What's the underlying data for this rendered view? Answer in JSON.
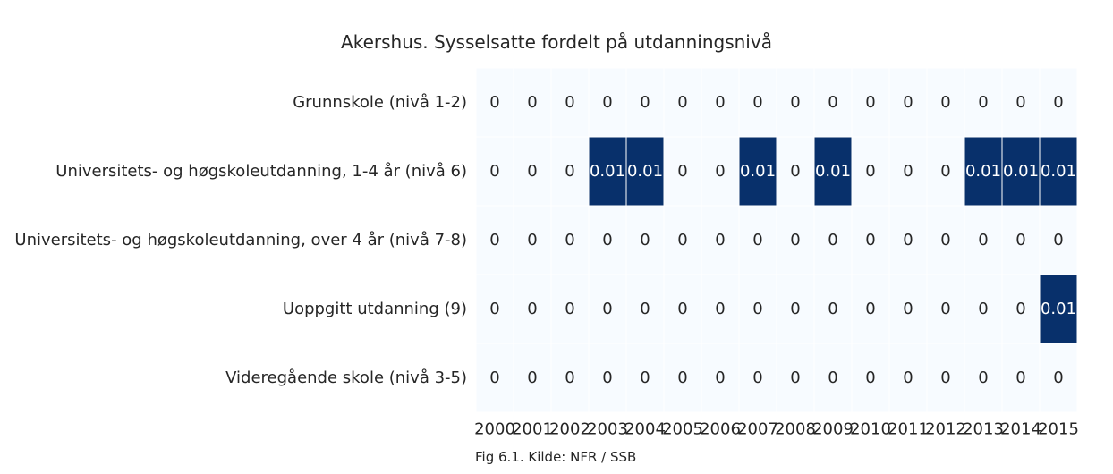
{
  "chart_data": {
    "type": "heatmap",
    "title": "Akershus. Sysselsatte fordelt på utdanningsnivå",
    "caption": "Fig 6.1. Kilde: NFR / SSB",
    "columns": [
      "2000",
      "2001",
      "2002",
      "2003",
      "2004",
      "2005",
      "2006",
      "2007",
      "2008",
      "2009",
      "2010",
      "2011",
      "2012",
      "2013",
      "2014",
      "2015"
    ],
    "rows": [
      "Grunnskole (nivå 1-2)",
      "Universitets- og høgskoleutdanning, 1-4 år (nivå 6)",
      "Universitets- og høgskoleutdanning, over 4 år (nivå 7-8)",
      "Uoppgitt utdanning (9)",
      "Videregående skole (nivå 3-5)"
    ],
    "values": [
      [
        0,
        0,
        0,
        0,
        0,
        0,
        0,
        0,
        0,
        0,
        0,
        0,
        0,
        0,
        0,
        0
      ],
      [
        0,
        0,
        0,
        0.01,
        0.01,
        0,
        0,
        0.01,
        0,
        0.01,
        0,
        0,
        0,
        0.01,
        0.01,
        0.01
      ],
      [
        0,
        0,
        0,
        0,
        0,
        0,
        0,
        0,
        0,
        0,
        0,
        0,
        0,
        0,
        0,
        0
      ],
      [
        0,
        0,
        0,
        0,
        0,
        0,
        0,
        0,
        0,
        0,
        0,
        0,
        0,
        0,
        0,
        0.01
      ],
      [
        0,
        0,
        0,
        0,
        0,
        0,
        0,
        0,
        0,
        0,
        0,
        0,
        0,
        0,
        0,
        0
      ]
    ],
    "color_low": "#f7fbff",
    "color_high": "#08306b",
    "grid": false
  }
}
